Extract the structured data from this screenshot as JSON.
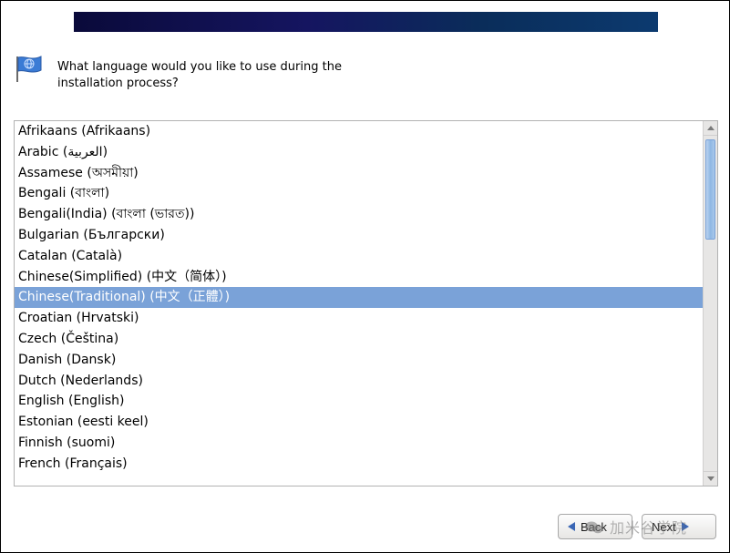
{
  "prompt": {
    "text": "What language would you like to use during the installation process?"
  },
  "languages": {
    "selected_index": 8,
    "items": [
      {
        "name": "Afrikaans",
        "native": "Afrikaans"
      },
      {
        "name": "Arabic",
        "native": "العربية"
      },
      {
        "name": "Assamese",
        "native": "অসমীয়া"
      },
      {
        "name": "Bengali",
        "native": "বাংলা"
      },
      {
        "name": "Bengali(India)",
        "native": "বাংলা (ভারত)"
      },
      {
        "name": "Bulgarian",
        "native": "Български"
      },
      {
        "name": "Catalan",
        "native": "Català"
      },
      {
        "name": "Chinese(Simplified)",
        "native": "中文（简体）"
      },
      {
        "name": "Chinese(Traditional)",
        "native": "中文（正體）"
      },
      {
        "name": "Croatian",
        "native": "Hrvatski"
      },
      {
        "name": "Czech",
        "native": "Čeština"
      },
      {
        "name": "Danish",
        "native": "Dansk"
      },
      {
        "name": "Dutch",
        "native": "Nederlands"
      },
      {
        "name": "English",
        "native": "English"
      },
      {
        "name": "Estonian",
        "native": "eesti keel"
      },
      {
        "name": "Finnish",
        "native": "suomi"
      },
      {
        "name": "French",
        "native": "Français"
      }
    ]
  },
  "buttons": {
    "back_label": "Back",
    "next_label": "Next"
  },
  "watermark": {
    "text": "加米谷学院"
  },
  "colors": {
    "selection": "#7aa2d8",
    "banner_dark": "#0a0a3a",
    "banner_light": "#0c3a6f"
  }
}
